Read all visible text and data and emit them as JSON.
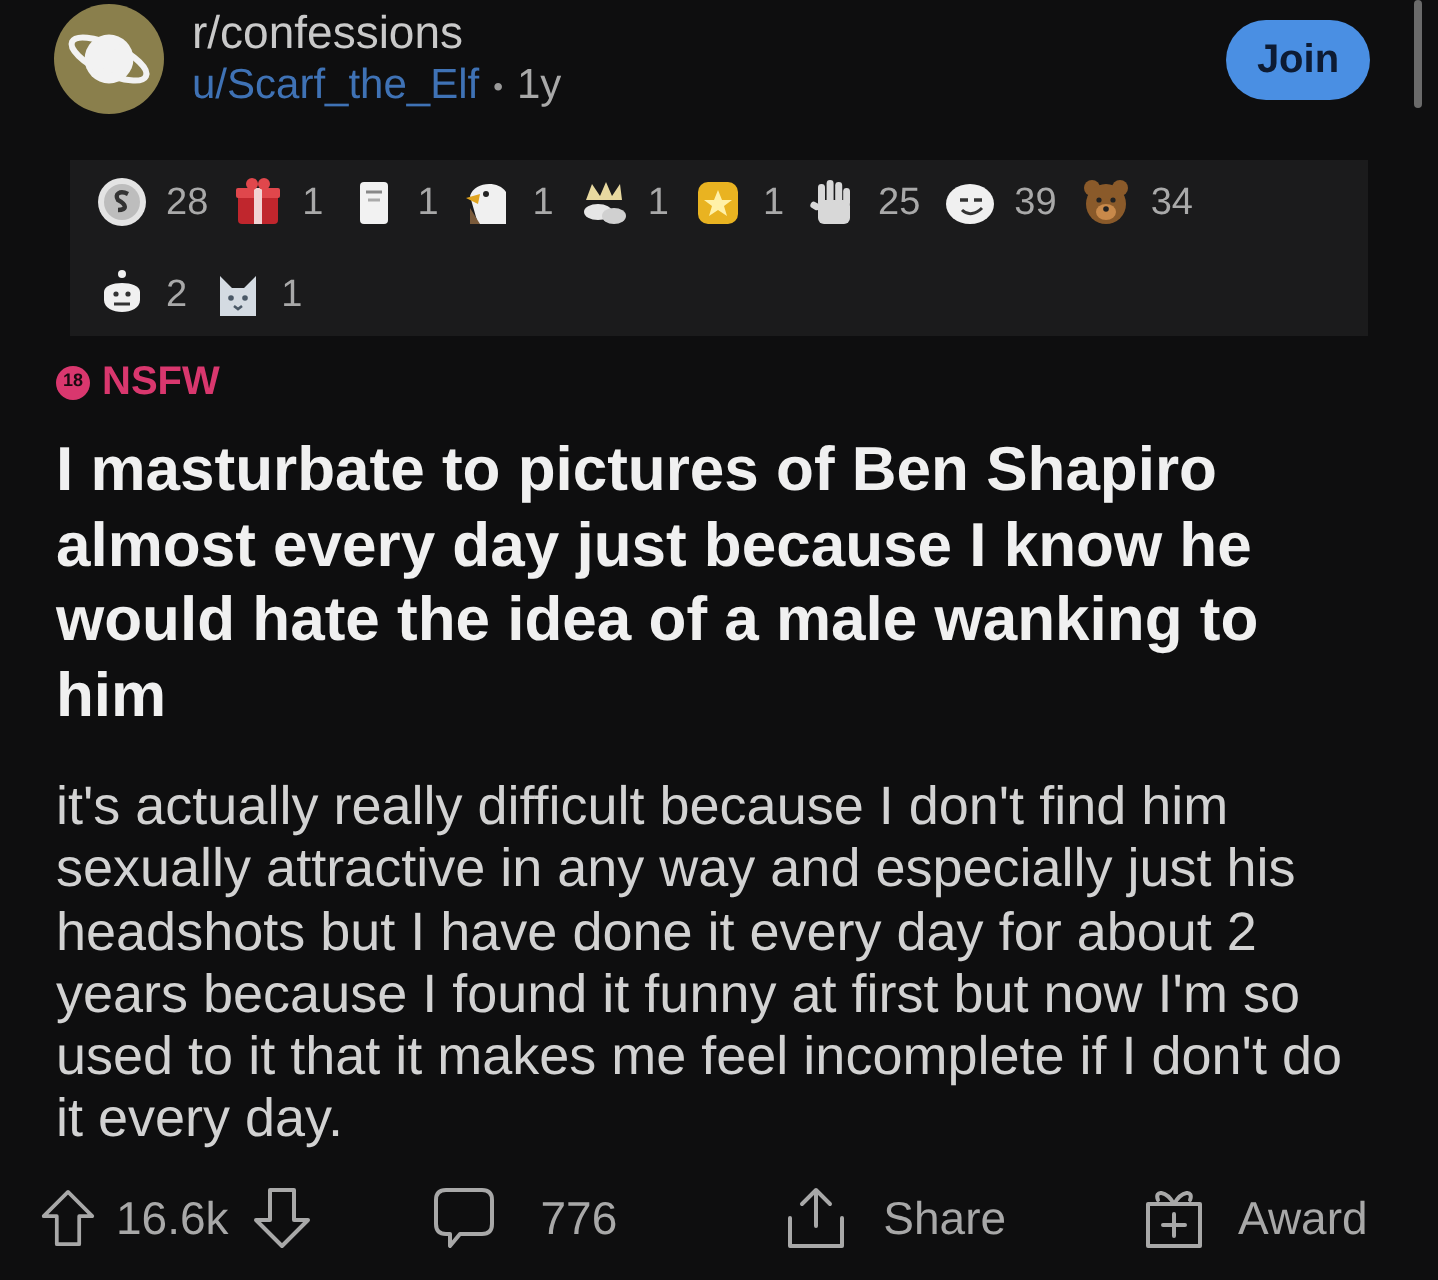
{
  "header": {
    "subreddit": "r/confessions",
    "user": "u/Scarf_the_Elf",
    "separator": "•",
    "age": "1y",
    "join_button": "Join"
  },
  "awards": [
    {
      "count": "28"
    },
    {
      "count": "1"
    },
    {
      "count": "1"
    },
    {
      "count": "1"
    },
    {
      "count": "1"
    },
    {
      "count": "1"
    },
    {
      "count": "25"
    },
    {
      "count": "39"
    },
    {
      "count": "34"
    },
    {
      "count": "2"
    },
    {
      "count": "1"
    }
  ],
  "nsfw": {
    "badge": "18",
    "label": "NSFW"
  },
  "title": "I masturbate to pictures of Ben Shapiro almost every day just because I know he would hate the idea of a male wanking to him",
  "body": "it's actually really difficult because I don't find him sexually attractive in any way and especially just his headshots but I have done it every day for about 2 years because I found it funny at first but now I'm so used to it that it makes me feel incomplete if I don't do it every day.",
  "actions": {
    "votes": "16.6k",
    "comments": "776",
    "share": "Share",
    "award": "Award"
  }
}
